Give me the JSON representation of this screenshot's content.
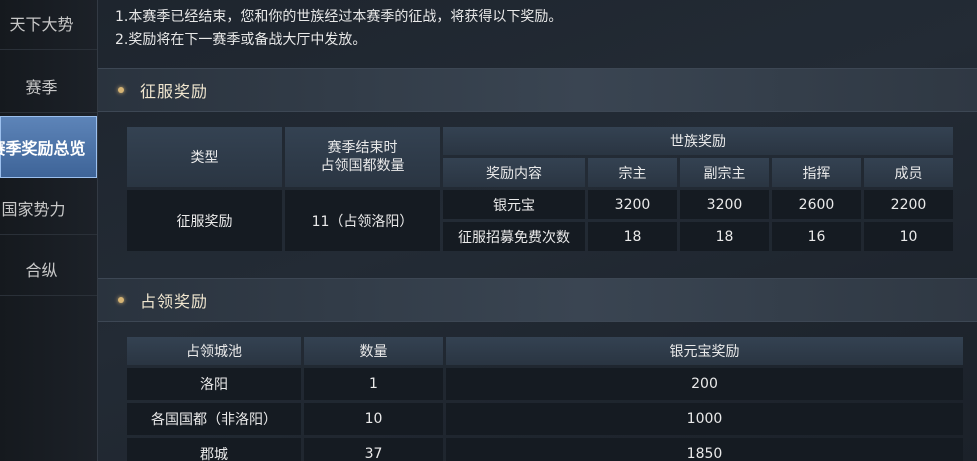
{
  "sidebar": {
    "items": [
      {
        "label": "天下大势"
      },
      {
        "label": "赛季"
      },
      {
        "label": "赛季奖励总览"
      },
      {
        "label": "国家势力"
      },
      {
        "label": "合纵"
      }
    ]
  },
  "notice": {
    "line1": "1.本赛季已经结束，您和你的世族经过本赛季的征战，将获得以下奖励。",
    "line2": "2.奖励将在下一赛季或备战大厅中发放。"
  },
  "conquest": {
    "section_title": "征服奖励",
    "headers": {
      "type": "类型",
      "capitals_line1": "赛季结束时",
      "capitals_line2": "占领国都数量",
      "clan_reward": "世族奖励",
      "content": "奖励内容",
      "roles": [
        "宗主",
        "副宗主",
        "指挥",
        "成员"
      ]
    },
    "row": {
      "type": "征服奖励",
      "capitals": "11（占领洛阳）",
      "items": [
        {
          "name": "银元宝",
          "values": [
            "3200",
            "3200",
            "2600",
            "2200"
          ]
        },
        {
          "name": "征服招募免费次数",
          "values": [
            "18",
            "18",
            "16",
            "10"
          ]
        }
      ]
    }
  },
  "occupation": {
    "section_title": "占领奖励",
    "headers": {
      "city": "占领城池",
      "count": "数量",
      "reward": "银元宝奖励"
    },
    "rows": [
      {
        "city": "洛阳",
        "count": "1",
        "reward": "200"
      },
      {
        "city": "各国国都（非洛阳）",
        "count": "10",
        "reward": "1000"
      },
      {
        "city": "郡城",
        "count": "37",
        "reward": "1850"
      }
    ]
  }
}
